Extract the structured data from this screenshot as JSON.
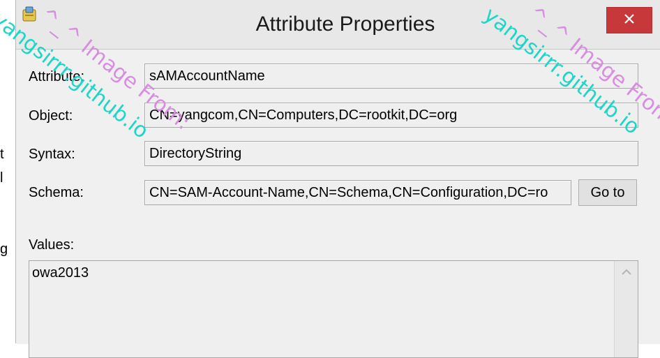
{
  "window": {
    "title": "Attribute Properties",
    "close_icon": "close-icon",
    "app_icon": "properties-app-icon"
  },
  "background_window": {
    "fragments": [
      "t",
      "l",
      "g"
    ]
  },
  "fields": {
    "attribute": {
      "label": "Attribute:",
      "value": "sAMAccountName"
    },
    "object": {
      "label": "Object:",
      "value": "CN=yangcom,CN=Computers,DC=rootkit,DC=org"
    },
    "syntax": {
      "label": "Syntax:",
      "value": "DirectoryString"
    },
    "schema": {
      "label": "Schema:",
      "value": "CN=SAM-Account-Name,CN=Schema,CN=Configuration,DC=ro"
    }
  },
  "goto_button": {
    "label": "Go to"
  },
  "values": {
    "label": "Values:",
    "items": [
      "owa2013"
    ]
  },
  "watermarks": {
    "left_cyan": "yangsirrr.github.io",
    "left_violet": "^_^ Image From:",
    "right_cyan": "yangsirrr.github.io",
    "right_violet": "^_^ Image From:"
  },
  "colors": {
    "close_button": "#c7383a",
    "dialog_bg": "#f0f0f0",
    "watermark_cyan": "#1cd6c8",
    "watermark_violet": "#d88ee0"
  }
}
